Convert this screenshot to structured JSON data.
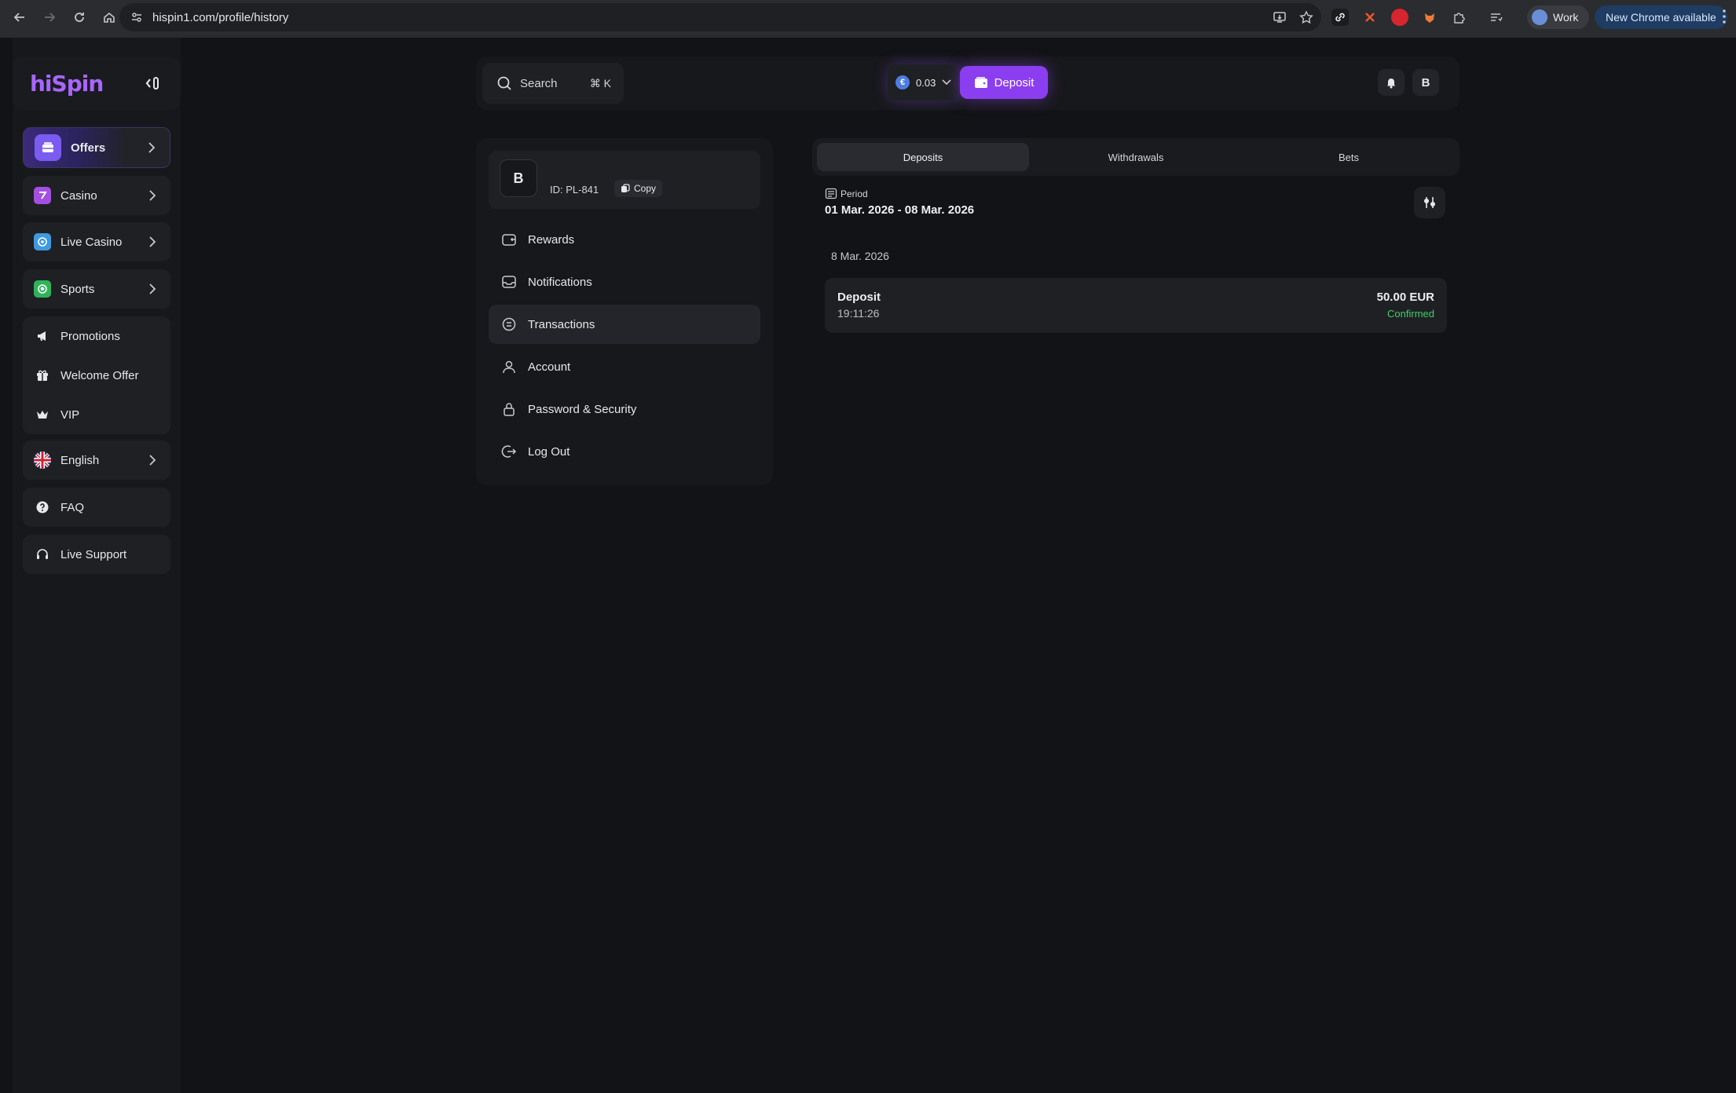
{
  "browser": {
    "url": "hispin1.com/profile/history",
    "profile_label": "Work",
    "update_label": "New Chrome available"
  },
  "sidebar": {
    "logo": "hiSpin",
    "items": [
      {
        "label": "Offers",
        "icon": "offers-icon"
      },
      {
        "label": "Casino",
        "icon": "casino-icon"
      },
      {
        "label": "Live Casino",
        "icon": "live-casino-icon"
      },
      {
        "label": "Sports",
        "icon": "sports-icon"
      },
      {
        "label": "Promotions",
        "icon": "megaphone-icon"
      },
      {
        "label": "Welcome Offer",
        "icon": "gift-icon"
      },
      {
        "label": "VIP",
        "icon": "crown-icon"
      },
      {
        "label": "English",
        "icon": "uk-flag-icon"
      },
      {
        "label": "FAQ",
        "icon": "question-icon"
      },
      {
        "label": "Live Support",
        "icon": "headset-icon"
      }
    ]
  },
  "header": {
    "search_label": "Search",
    "search_shortcut": "⌘ K",
    "balance": "0.03",
    "deposit_label": "Deposit",
    "user_initial": "B"
  },
  "profile": {
    "initial": "B",
    "id_text": "ID: PL-841",
    "copy_label": "Copy",
    "menu": [
      {
        "label": "Rewards"
      },
      {
        "label": "Notifications"
      },
      {
        "label": "Transactions"
      },
      {
        "label": "Account"
      },
      {
        "label": "Password & Security"
      },
      {
        "label": "Log Out"
      }
    ]
  },
  "transactions": {
    "tabs": [
      "Deposits",
      "Withdrawals",
      "Bets"
    ],
    "active_tab": "Deposits",
    "period_label": "Period",
    "period_value": "01 Mar. 2026 - 08 Mar. 2026",
    "groups": [
      {
        "date": "8 Mar. 2026",
        "items": [
          {
            "type": "Deposit",
            "time": "19:11:26",
            "amount": "50.00 EUR",
            "status": "Confirmed"
          }
        ]
      }
    ]
  },
  "colors": {
    "accent": "#8a3ef0",
    "background": "#121316",
    "success": "#3fcf6a"
  }
}
